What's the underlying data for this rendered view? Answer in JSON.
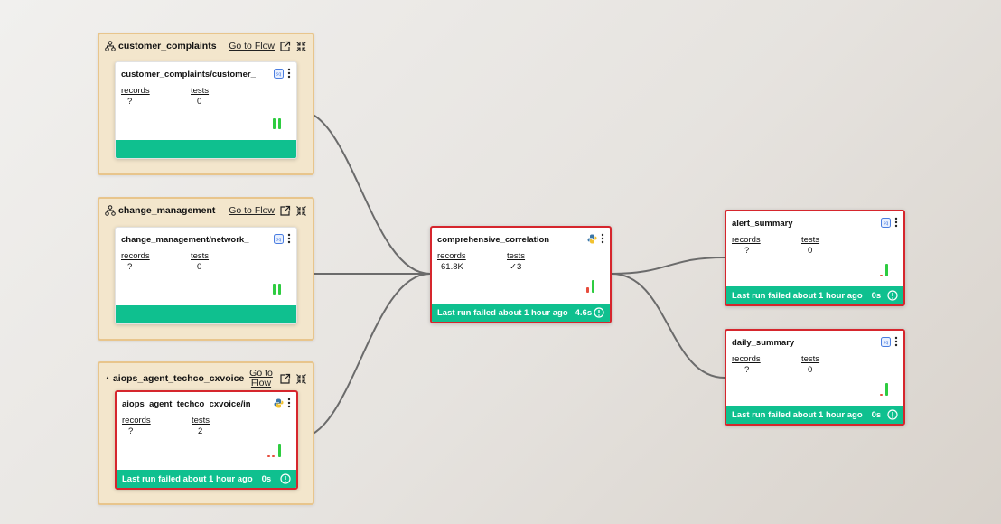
{
  "colors": {
    "failed_border": "#d6262d",
    "status_green": "#0fc08f",
    "flow_bg": "#f3e6cc",
    "flow_border": "#e8c58c",
    "bar_green": "#2ecc40",
    "bar_red": "#e74c3c"
  },
  "flows": [
    {
      "name": "customer_complaints",
      "goto": "Go to Flow",
      "icons": [
        "flow-icon",
        "external-link-icon",
        "collapse-icon"
      ]
    },
    {
      "name": "change_management",
      "goto": "Go to Flow",
      "icons": [
        "flow-icon",
        "external-link-icon",
        "collapse-icon"
      ]
    },
    {
      "name": "aiops_agent_techco_cxvoice",
      "goto": "Go to Flow",
      "icons": [
        "dot-icon",
        "external-link-icon",
        "collapse-icon"
      ]
    }
  ],
  "nodes": {
    "customer_complaints_node": {
      "title": "customer_complaints/customer_",
      "icon": "sql-icon",
      "records_label": "records",
      "records": "?",
      "tests_label": "tests",
      "tests": "0",
      "status": ""
    },
    "change_management_node": {
      "title": "change_management/network_",
      "icon": "sql-icon",
      "records_label": "records",
      "records": "?",
      "tests_label": "tests",
      "tests": "0",
      "status": ""
    },
    "aiops_node": {
      "title": "aiops_agent_techco_cxvoice/in",
      "icon": "python-icon",
      "records_label": "records",
      "records": "?",
      "tests_label": "tests",
      "tests": "2",
      "status": "Last run failed about 1 hour ago",
      "duration": "0s"
    },
    "comprehensive_correlation": {
      "title": "comprehensive_correlation",
      "icon": "python-icon",
      "records_label": "records",
      "records": "61.8K",
      "tests_label": "tests",
      "tests": "3",
      "status": "Last run failed about 1 hour ago",
      "duration": "4.6s"
    },
    "alert_summary": {
      "title": "alert_summary",
      "icon": "sql-icon",
      "records_label": "records",
      "records": "?",
      "tests_label": "tests",
      "tests": "0",
      "status": "Last run failed about 1 hour ago",
      "duration": "0s"
    },
    "daily_summary": {
      "title": "daily_summary",
      "icon": "sql-icon",
      "records_label": "records",
      "records": "?",
      "tests_label": "tests",
      "tests": "0",
      "status": "Last run failed about 1 hour ago",
      "duration": "0s"
    }
  }
}
